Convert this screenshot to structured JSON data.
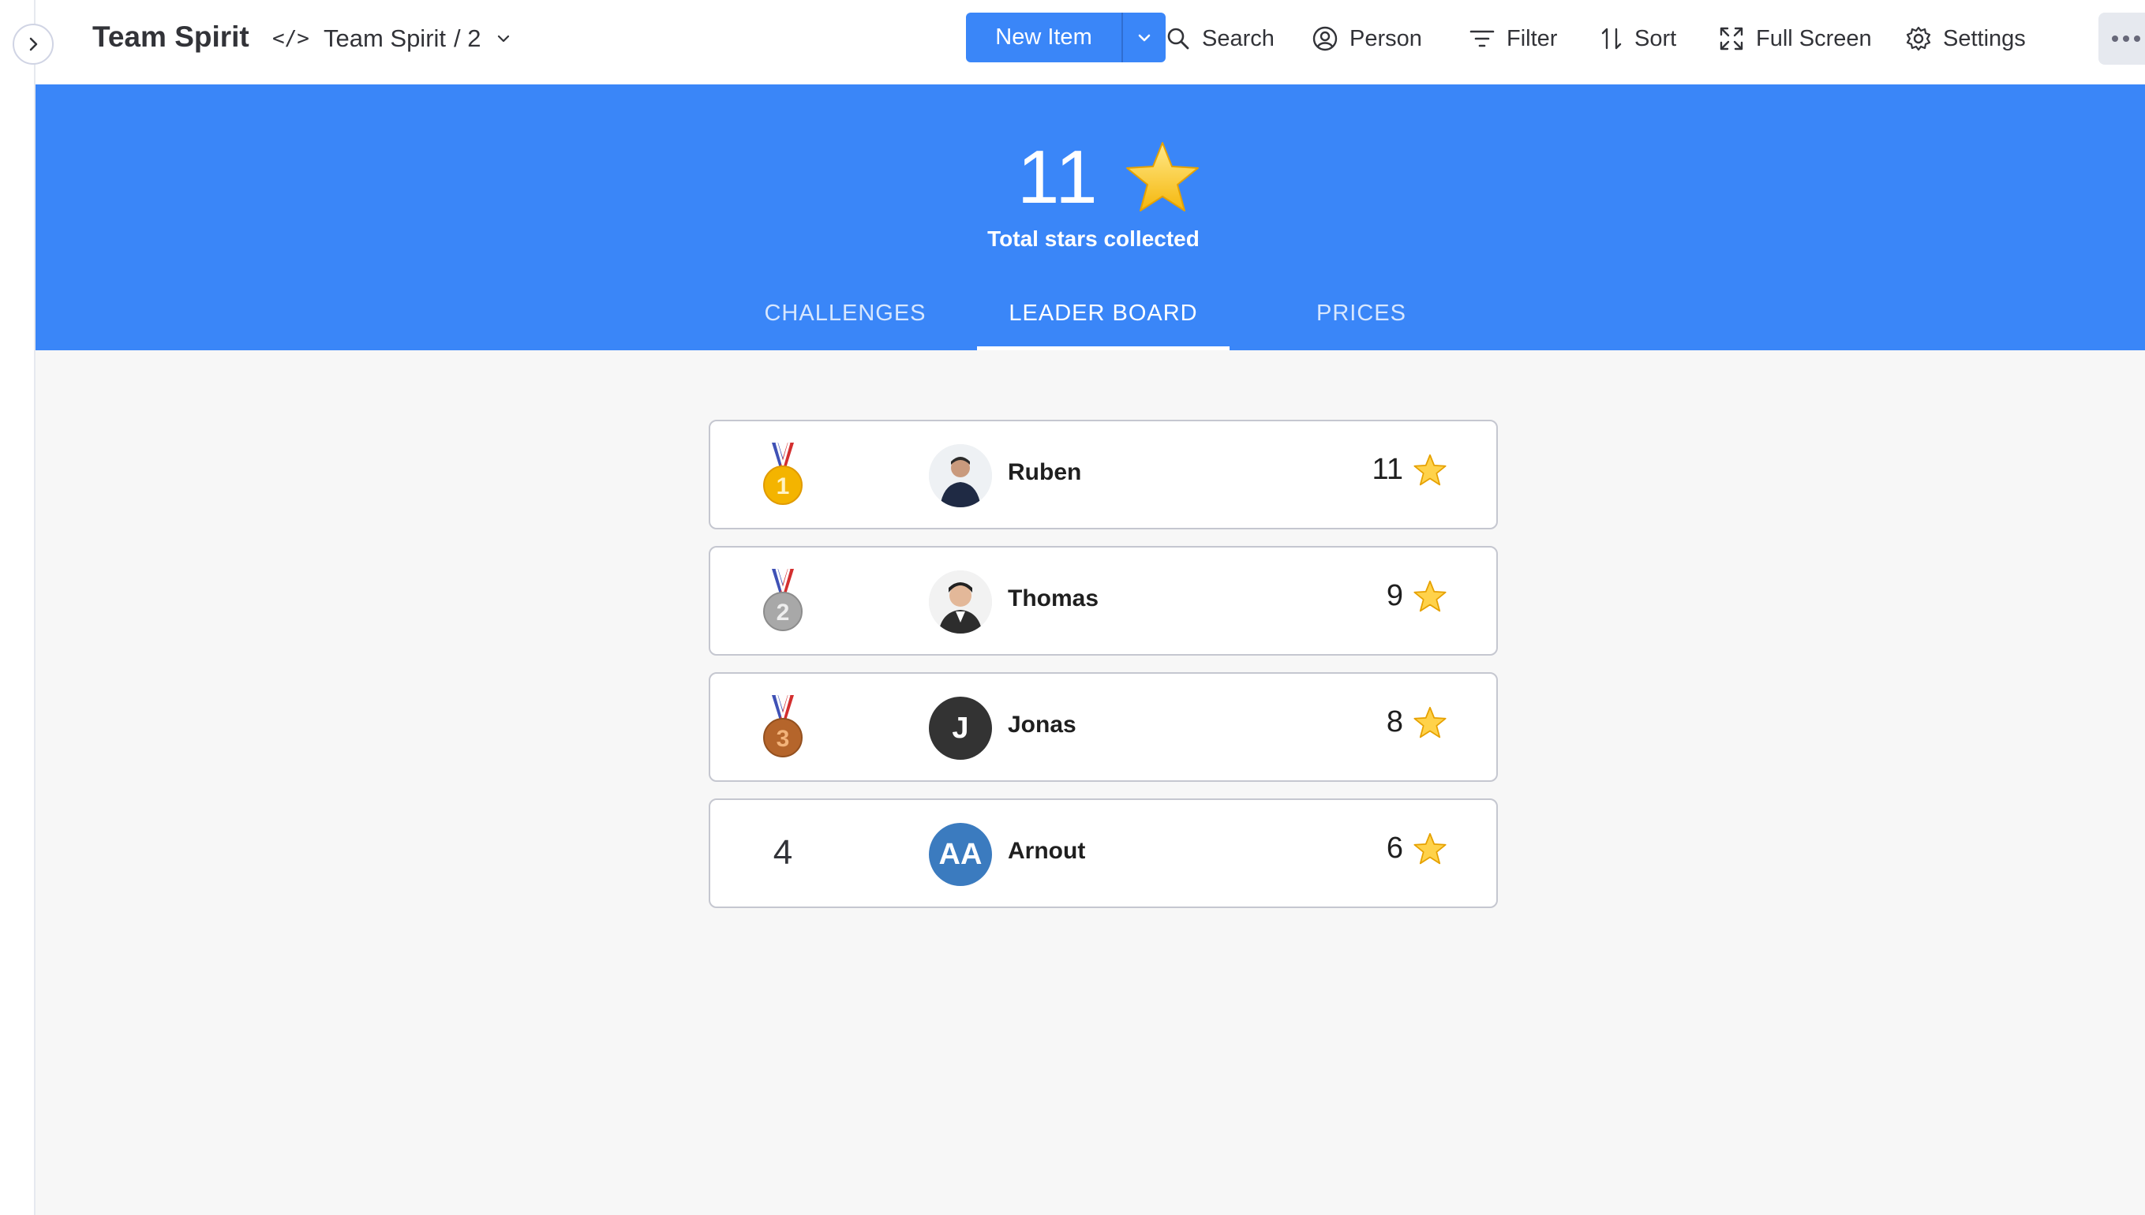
{
  "board": {
    "title": "Team Spirit"
  },
  "view": {
    "name": "Team Spirit",
    "suffix": "/ 2"
  },
  "toolbar": {
    "new_item": "New Item",
    "search": "Search",
    "person": "Person",
    "filter": "Filter",
    "sort": "Sort",
    "full_screen": "Full Screen",
    "settings": "Settings"
  },
  "hero": {
    "total": "11",
    "caption": "Total stars collected"
  },
  "tabs": [
    {
      "label": "CHALLENGES",
      "active": false
    },
    {
      "label": "LEADER BOARD",
      "active": true
    },
    {
      "label": "PRICES",
      "active": false
    }
  ],
  "leaderboard": [
    {
      "rank": "1",
      "medal": "gold-medal-icon",
      "name": "Ruben",
      "avatar": "photo",
      "stars": "11"
    },
    {
      "rank": "2",
      "medal": "silver-medal-icon",
      "name": "Thomas",
      "avatar": "photo",
      "stars": "9"
    },
    {
      "rank": "3",
      "medal": "bronze-medal-icon",
      "name": "Jonas",
      "avatar_initials": "J",
      "avatar_color": "#333333",
      "stars": "8"
    },
    {
      "rank": "4",
      "name": "Arnout",
      "avatar_initials": "AA",
      "avatar_color": "#3b7bbf",
      "stars": "6"
    }
  ],
  "colors": {
    "accent": "#3a86f8",
    "gold": "#f4b400",
    "silver": "#9e9e9e",
    "bronze": "#b5652b"
  }
}
